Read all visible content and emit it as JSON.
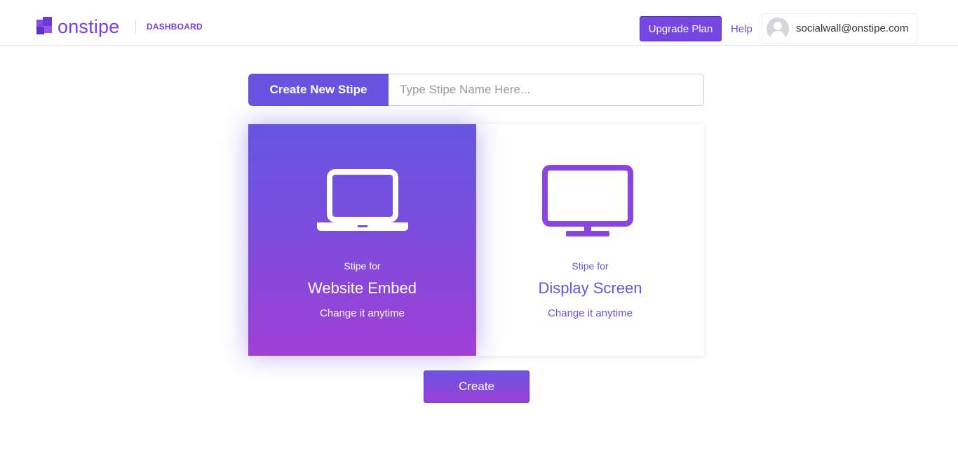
{
  "header": {
    "logo_text": "onstipe",
    "nav_label": "DASHBOARD",
    "upgrade_label": "Upgrade Plan",
    "help_label": "Help",
    "user_email": "socialwall@onstipe.com"
  },
  "create": {
    "label": "Create New Stipe",
    "input_placeholder": "Type Stipe Name Here...",
    "input_value": ""
  },
  "options": [
    {
      "subtitle": "Stipe for",
      "title": "Website Embed",
      "note": "Change it anytime",
      "icon": "laptop-icon",
      "selected": true
    },
    {
      "subtitle": "Stipe for",
      "title": "Display Screen",
      "note": "Change it anytime",
      "icon": "monitor-icon",
      "selected": false
    }
  ],
  "actions": {
    "create_label": "Create"
  },
  "colors": {
    "brand": "#7b3fe0",
    "accent": "#6a52e0",
    "gradient_start": "#6655e2",
    "gradient_end": "#a03fd6"
  }
}
